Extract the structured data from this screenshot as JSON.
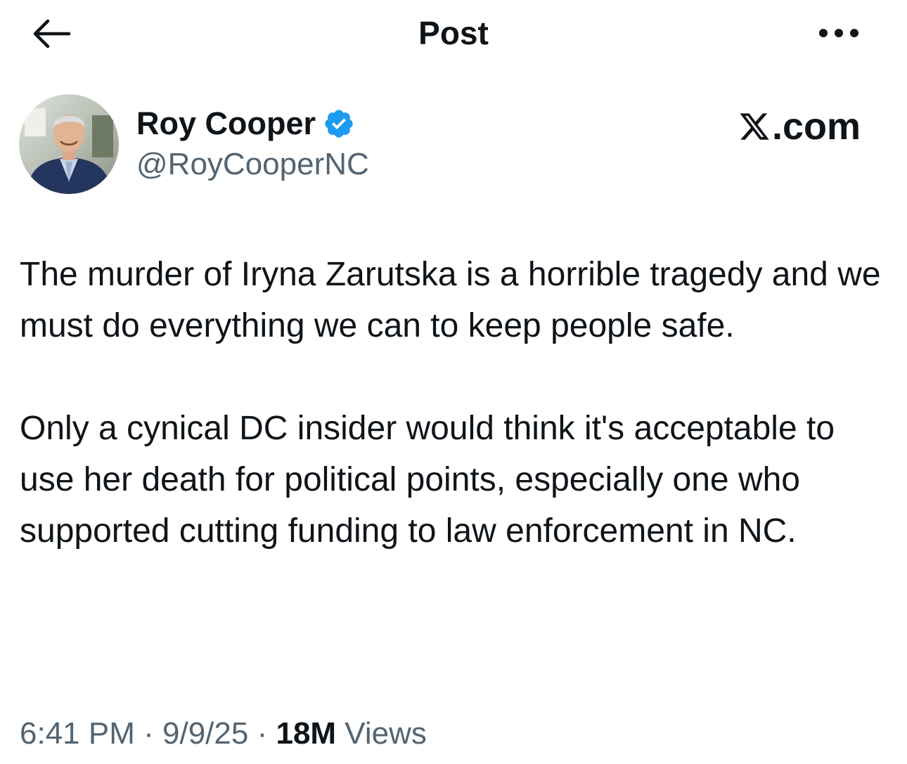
{
  "header": {
    "title": "Post",
    "back_icon": "arrow-left-icon",
    "more_icon": "more-horizontal-icon"
  },
  "author": {
    "name": "Roy Cooper",
    "handle": "@RoyCooperNC",
    "verified": true,
    "verified_color": "#1d9bf0",
    "avatar_icon": "profile-photo"
  },
  "source": {
    "label": ".com",
    "logo_icon": "x-logo-icon"
  },
  "tweet": {
    "paragraphs": [
      "The murder of Iryna Zarutska is a horrible tragedy and we must do everything we can to keep people safe.",
      "Only a cynical DC insider would think it's acceptable to use her death for political points, especially one who supported cutting funding to law enforcement in NC."
    ]
  },
  "meta": {
    "time": "6:41 PM",
    "date": "9/9/25",
    "separator": "·",
    "views_count": "18M",
    "views_label": "Views"
  },
  "colors": {
    "text": "#0f1419",
    "secondary": "#536471",
    "accent": "#1d9bf0",
    "background": "#ffffff"
  }
}
